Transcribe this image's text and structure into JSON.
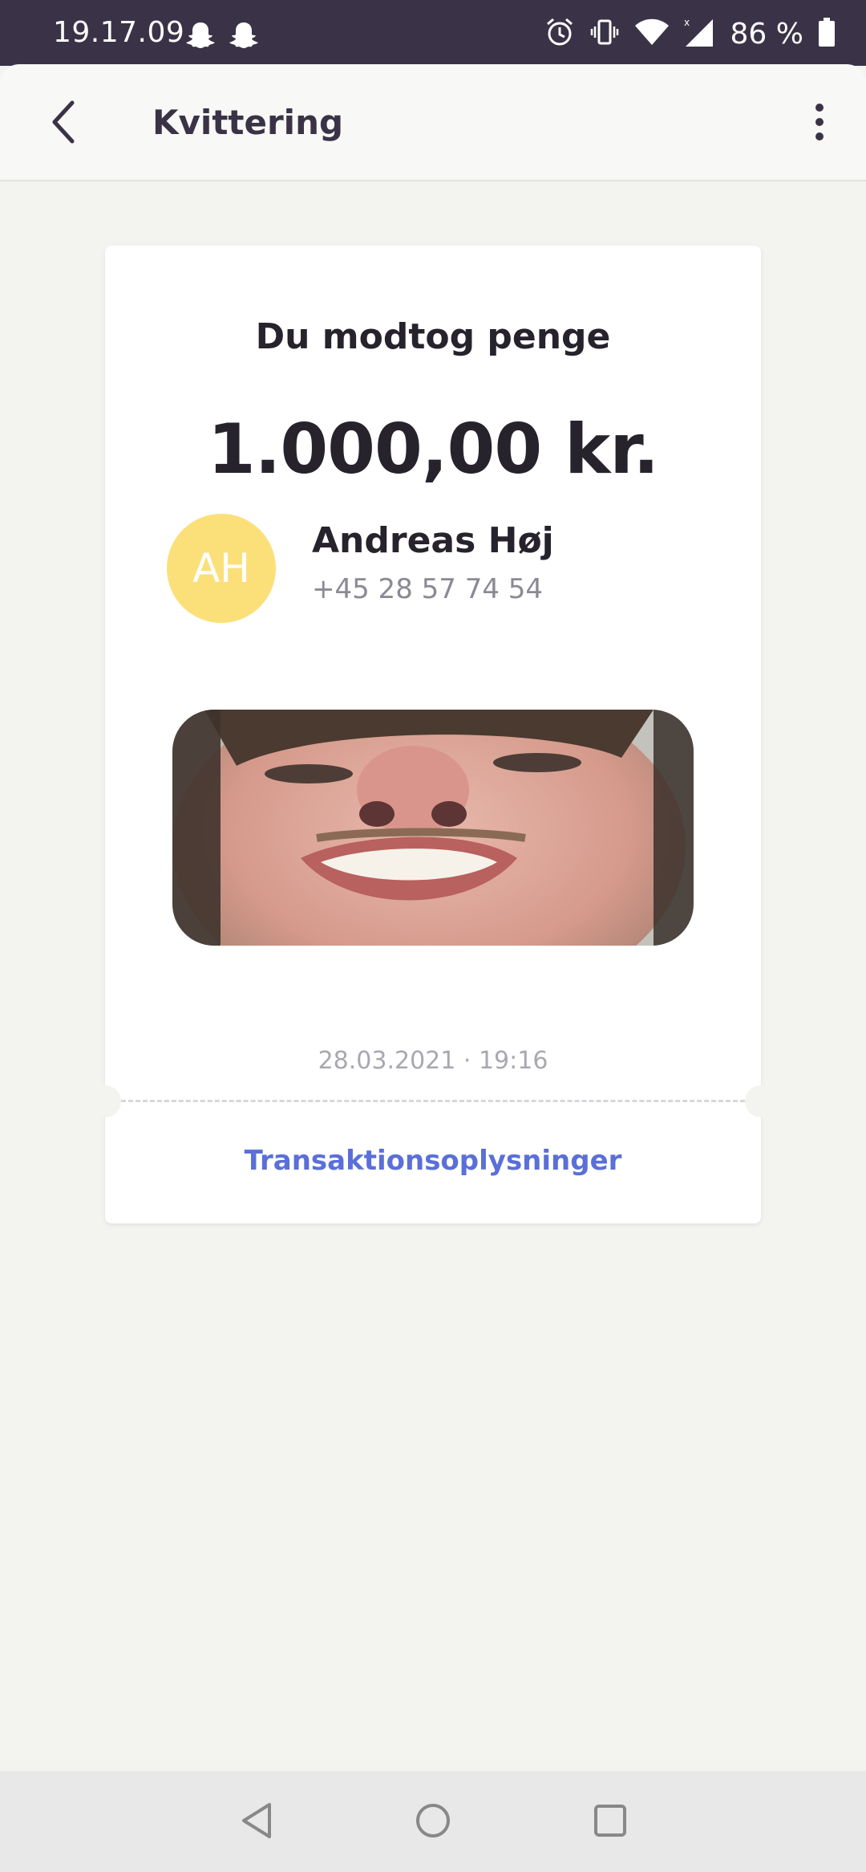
{
  "status_bar": {
    "time": "19.17.09",
    "battery_percent": "86 %",
    "icons": [
      "snapchat-icon",
      "snapchat-icon",
      "alarm-icon",
      "vibrate-icon",
      "wifi-icon",
      "signal-icon",
      "battery-icon"
    ]
  },
  "app_bar": {
    "title": "Kvittering",
    "back_icon": "chevron-left-icon",
    "menu_icon": "more-vertical-icon"
  },
  "receipt": {
    "heading": "Du modtog penge",
    "amount": "1.000,00 kr.",
    "sender": {
      "initials": "AH",
      "name": "Andreas Høj",
      "phone": "+45 28 57 74 54"
    },
    "attachment": "photo of sender's face (selfie)",
    "date": "28.03.2021 · 19:16",
    "details_link": "Transaktionsoplysninger"
  },
  "colors": {
    "status_bar_bg": "#3a3347",
    "avatar_bg": "#fbe07a",
    "link": "#5a6fd8",
    "background": "#f3f3ef"
  },
  "nav_bar": {
    "buttons": [
      "nav-back-icon",
      "nav-home-icon",
      "nav-recents-icon"
    ]
  }
}
